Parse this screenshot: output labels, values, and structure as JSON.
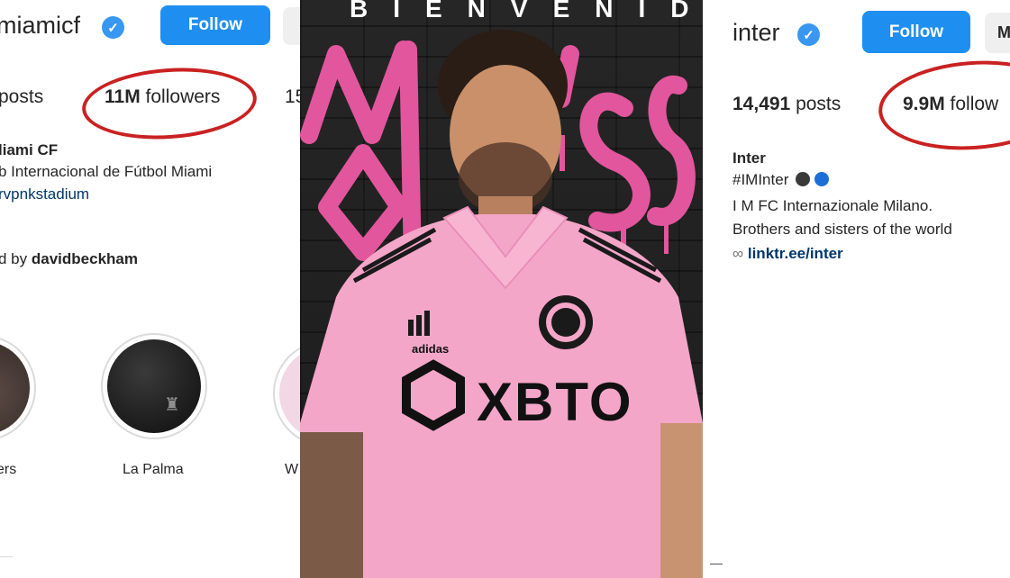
{
  "left_profile": {
    "username": "miamicf",
    "follow_label": "Follow",
    "stats": {
      "posts_label": "posts",
      "followers_value": "11M",
      "followers_label": "followers",
      "following_partial": "15"
    },
    "bio": {
      "name": "liami CF",
      "line1": "b Internacional de Fútbol Miami",
      "line2": "rvpnkstadium",
      "followed_by_prefix": "d by",
      "followed_by_user": "davidbeckham"
    },
    "highlights": [
      {
        "label": "ers"
      },
      {
        "label": "La Palma"
      },
      {
        "label": "W"
      }
    ]
  },
  "poster": {
    "title": "BIENVENIDO",
    "sponsor": "XBTO",
    "kit_brand": "adidas",
    "colors": {
      "jersey": "#f4a6c8",
      "graffiti": "#e2569d",
      "wall": "#232323"
    }
  },
  "right_profile": {
    "username": "inter",
    "follow_label": "Follow",
    "more_label": "M",
    "stats": {
      "posts_value": "14,491",
      "posts_label": "posts",
      "followers_value": "9.9M",
      "followers_label": "follow"
    },
    "bio": {
      "name": "Inter",
      "hashtag": "#IMInter",
      "line1": "I M FC Internazionale Milano.",
      "line2": "Brothers and sisters of the world",
      "link": "linktr.ee/inter"
    }
  },
  "colors": {
    "follow_button": "#1e8ff0",
    "verified": "#3897f0",
    "circle_annotation": "#c92121"
  }
}
